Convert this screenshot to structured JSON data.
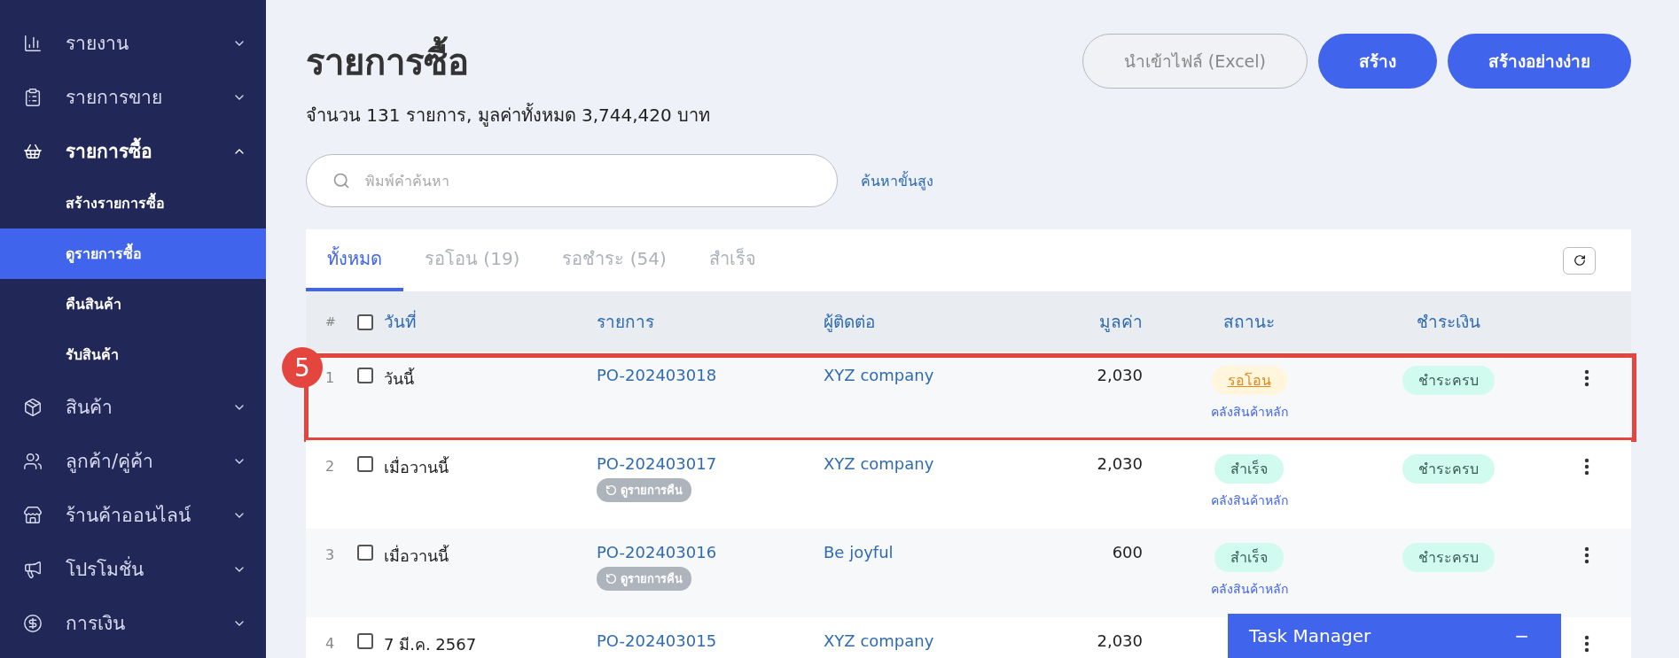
{
  "sidebar": {
    "items": [
      {
        "label": "รายงาน",
        "expanded": false
      },
      {
        "label": "รายการขาย",
        "expanded": false
      },
      {
        "label": "รายการซื้อ",
        "expanded": true,
        "children": [
          {
            "label": "สร้างรายการซื้อ",
            "selected": false
          },
          {
            "label": "ดูรายการซื้อ",
            "selected": true
          },
          {
            "label": "คืนสินค้า",
            "selected": false
          },
          {
            "label": "รับสินค้า",
            "selected": false
          }
        ]
      },
      {
        "label": "สินค้า",
        "expanded": false
      },
      {
        "label": "ลูกค้า/คู่ค้า",
        "expanded": false
      },
      {
        "label": "ร้านค้าออนไลน์",
        "expanded": false
      },
      {
        "label": "โปรโมชั่น",
        "expanded": false
      },
      {
        "label": "การเงิน",
        "expanded": false
      }
    ]
  },
  "page": {
    "title": "รายการซื้อ",
    "summary": "จำนวน 131 รายการ, มูลค่าทั้งหมด 3,744,420 บาท"
  },
  "actions": [
    {
      "label": "นำเข้าไฟล์ (Excel)",
      "kind": "secondary"
    },
    {
      "label": "สร้าง",
      "kind": "primary"
    },
    {
      "label": "สร้างอย่างง่าย",
      "kind": "primary"
    }
  ],
  "search": {
    "placeholder": "พิมพ์คำค้นหา",
    "advanced_link": "ค้นหาขั้นสูง"
  },
  "tabs": [
    {
      "label": "ทั้งหมด",
      "selected": true
    },
    {
      "label": "รอโอน (19)",
      "selected": false
    },
    {
      "label": "รอชำระ (54)",
      "selected": false
    },
    {
      "label": "สำเร็จ",
      "selected": false
    }
  ],
  "table": {
    "columns": [
      "#",
      "วันที่",
      "รายการ",
      "ผู้ติดต่อ",
      "มูลค่า",
      "สถานะ",
      "ชำระเงิน"
    ],
    "select_all_checked": false,
    "rows": [
      {
        "number": "1",
        "checked": false,
        "highlighted": true,
        "date": "วันนี้",
        "item": "PO-202403018",
        "contact": "XYZ company",
        "value": "2,030",
        "status": {
          "label": "รอโอน",
          "kind": "pending"
        },
        "warehouse": "คลังสินค้าหลัก",
        "payment": "ชำระครบ"
      },
      {
        "number": "2",
        "checked": false,
        "date": "เมื่อวานนี้",
        "item": "PO-202403017",
        "return_tag": "ดูรายการคืน",
        "contact": "XYZ company",
        "value": "2,030",
        "status": {
          "label": "สำเร็จ",
          "kind": "done"
        },
        "warehouse": "คลังสินค้าหลัก",
        "payment": "ชำระครบ"
      },
      {
        "number": "3",
        "checked": false,
        "date": "เมื่อวานนี้",
        "item": "PO-202403016",
        "return_tag": "ดูรายการคืน",
        "contact": "Be joyful",
        "value": "600",
        "status": {
          "label": "สำเร็จ",
          "kind": "done"
        },
        "warehouse": "คลังสินค้าหลัก",
        "payment": "ชำระครบ"
      },
      {
        "number": "4",
        "checked": false,
        "date": "7 มี.ค. 2567",
        "item": "PO-202403015",
        "contact": "XYZ company",
        "value": "2,030"
      }
    ]
  },
  "annotation": {
    "label": "5"
  },
  "task_manager": {
    "title": "Task Manager",
    "minimize": "−"
  }
}
